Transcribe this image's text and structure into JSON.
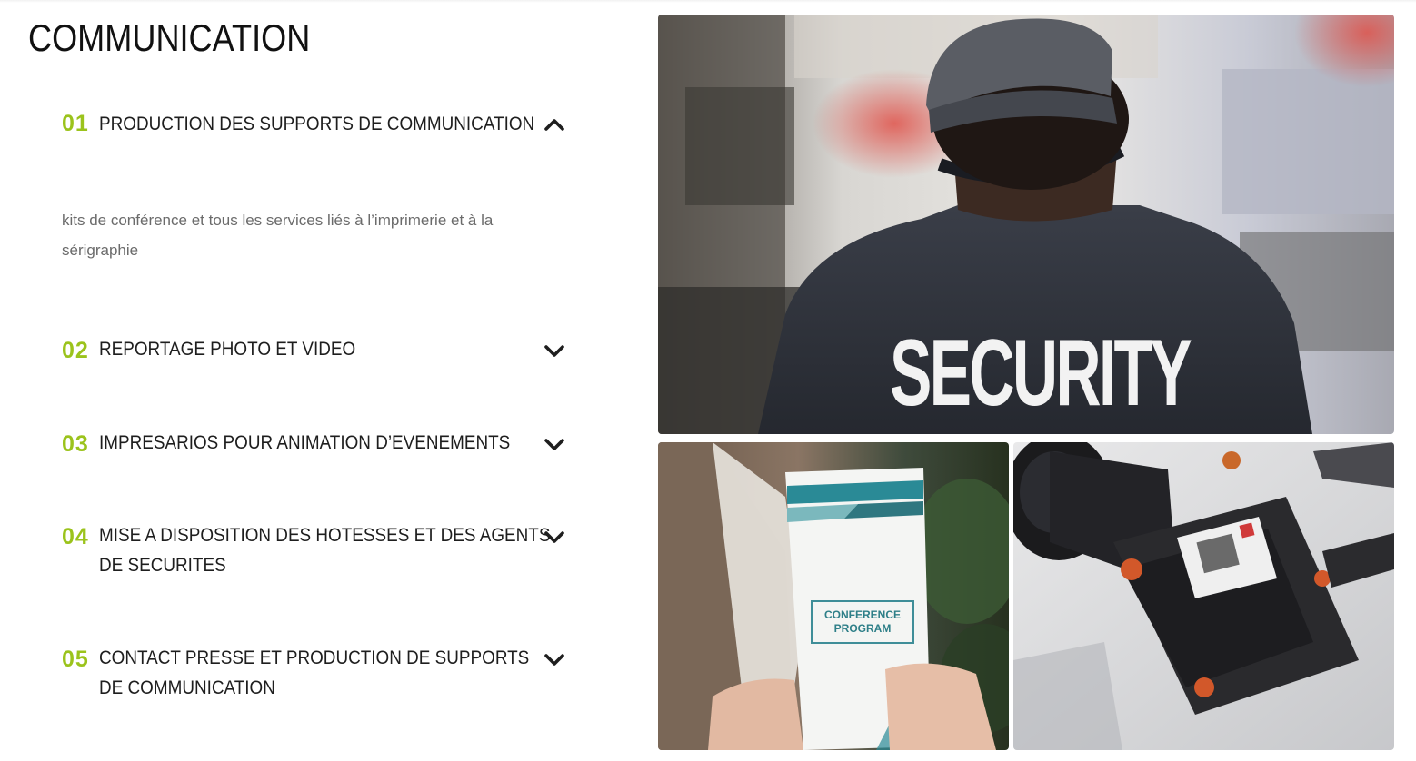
{
  "section": {
    "title": "COMMUNICATION"
  },
  "accordion": {
    "items": [
      {
        "number": "01",
        "label_lines": [
          "PRODUCTION DES SUPPORTS DE COMMUNICATION"
        ],
        "expanded": true,
        "chevron_icon": "chevron-up-icon",
        "content": "kits de conférence et tous les services liés à l’imprimerie et à la sérigraphie"
      },
      {
        "number": "02",
        "label_lines": [
          "REPORTAGE PHOTO ET VIDEO"
        ],
        "expanded": false,
        "chevron_icon": "chevron-down-icon"
      },
      {
        "number": "03",
        "label_lines": [
          "IMPRESARIOS POUR ANIMATION D’EVENEMENTS"
        ],
        "expanded": false,
        "chevron_icon": "chevron-down-icon"
      },
      {
        "number": "04",
        "label_lines": [
          "MISE A DISPOSITION DES HOTESSES ET DES AGENTS",
          "DE SECURITES"
        ],
        "expanded": false,
        "chevron_icon": "chevron-down-icon"
      },
      {
        "number": "05",
        "label_lines": [
          "CONTACT PRESSE ET PRODUCTION DE SUPPORTS",
          "DE COMMUNICATION"
        ],
        "expanded": false,
        "chevron_icon": "chevron-down-icon"
      }
    ]
  },
  "gallery": {
    "security_photo": {
      "shirt_text": "SECURITY"
    },
    "conference_photo": {
      "brochure_text_line1": "CONFERENCE",
      "brochure_text_line2": "PROGRAM"
    },
    "camera_photo": {}
  },
  "colors": {
    "accent_green": "#9bc31c",
    "text_dark": "#1e1e1e",
    "text_muted": "#6b6b6b",
    "divider": "#dedede"
  }
}
